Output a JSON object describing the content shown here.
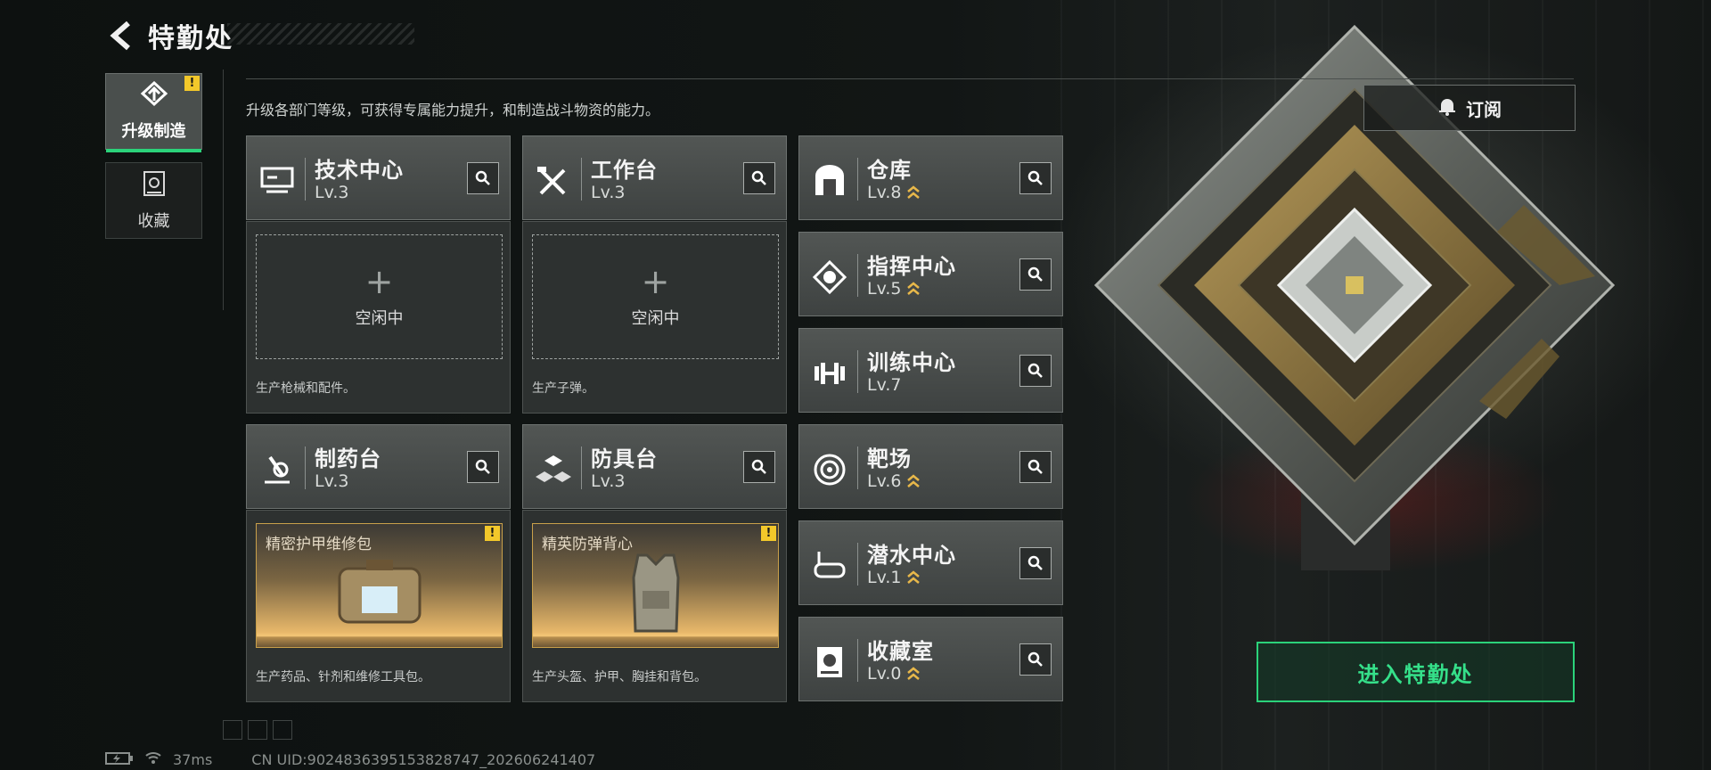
{
  "header": {
    "title": "特勤处"
  },
  "sidebar": {
    "tabs": [
      {
        "label": "升级制造",
        "active": true,
        "icon": "upgrade-icon",
        "warning": true
      },
      {
        "label": "收藏",
        "active": false,
        "icon": "collection-icon",
        "warning": false
      }
    ]
  },
  "description": "升级各部门等级，可获得专属能力提升，和制造战斗物资的能力。",
  "subscribe_label": "订阅",
  "departments": [
    {
      "name": "技术中心",
      "level": "Lv.3",
      "icon": "monitor-icon",
      "upgrade": false
    },
    {
      "name": "工作台",
      "level": "Lv.3",
      "icon": "tools-icon",
      "upgrade": false
    },
    {
      "name": "仓库",
      "level": "Lv.8",
      "icon": "warehouse-icon",
      "upgrade": true
    },
    {
      "name": "指挥中心",
      "level": "Lv.5",
      "icon": "chip-icon",
      "upgrade": true
    },
    {
      "name": "训练中心",
      "level": "Lv.7",
      "icon": "dumbbell-icon",
      "upgrade": false
    },
    {
      "name": "制药台",
      "level": "Lv.3",
      "icon": "microscope-icon",
      "upgrade": false
    },
    {
      "name": "防具台",
      "level": "Lv.3",
      "icon": "blocks-icon",
      "upgrade": false
    },
    {
      "name": "靶场",
      "level": "Lv.6",
      "icon": "target-icon",
      "upgrade": true
    },
    {
      "name": "潜水中心",
      "level": "Lv.1",
      "icon": "diving-mask-icon",
      "upgrade": true
    },
    {
      "name": "收藏室",
      "level": "Lv.0",
      "icon": "vault-icon",
      "upgrade": true
    }
  ],
  "production": {
    "tech": {
      "status": "空闲中",
      "desc": "生产枪械和配件。"
    },
    "workbench": {
      "status": "空闲中",
      "desc": "生产子弹。"
    },
    "pharmacy": {
      "item": "精密护甲维修包",
      "desc": "生产药品、针剂和维修工具包。",
      "warning": true
    },
    "armor": {
      "item": "精英防弹背心",
      "desc": "生产头盔、护甲、胸挂和背包。",
      "warning": true
    }
  },
  "enter_label": "进入特勤处",
  "status_bar": {
    "ping": "37ms",
    "uid": "CN UID:9024836395153828747_202606241407"
  },
  "colors": {
    "accent_green": "#2bd27a",
    "warning_yellow": "#f3c82a",
    "upgrade_gold": "#e8b84a"
  }
}
